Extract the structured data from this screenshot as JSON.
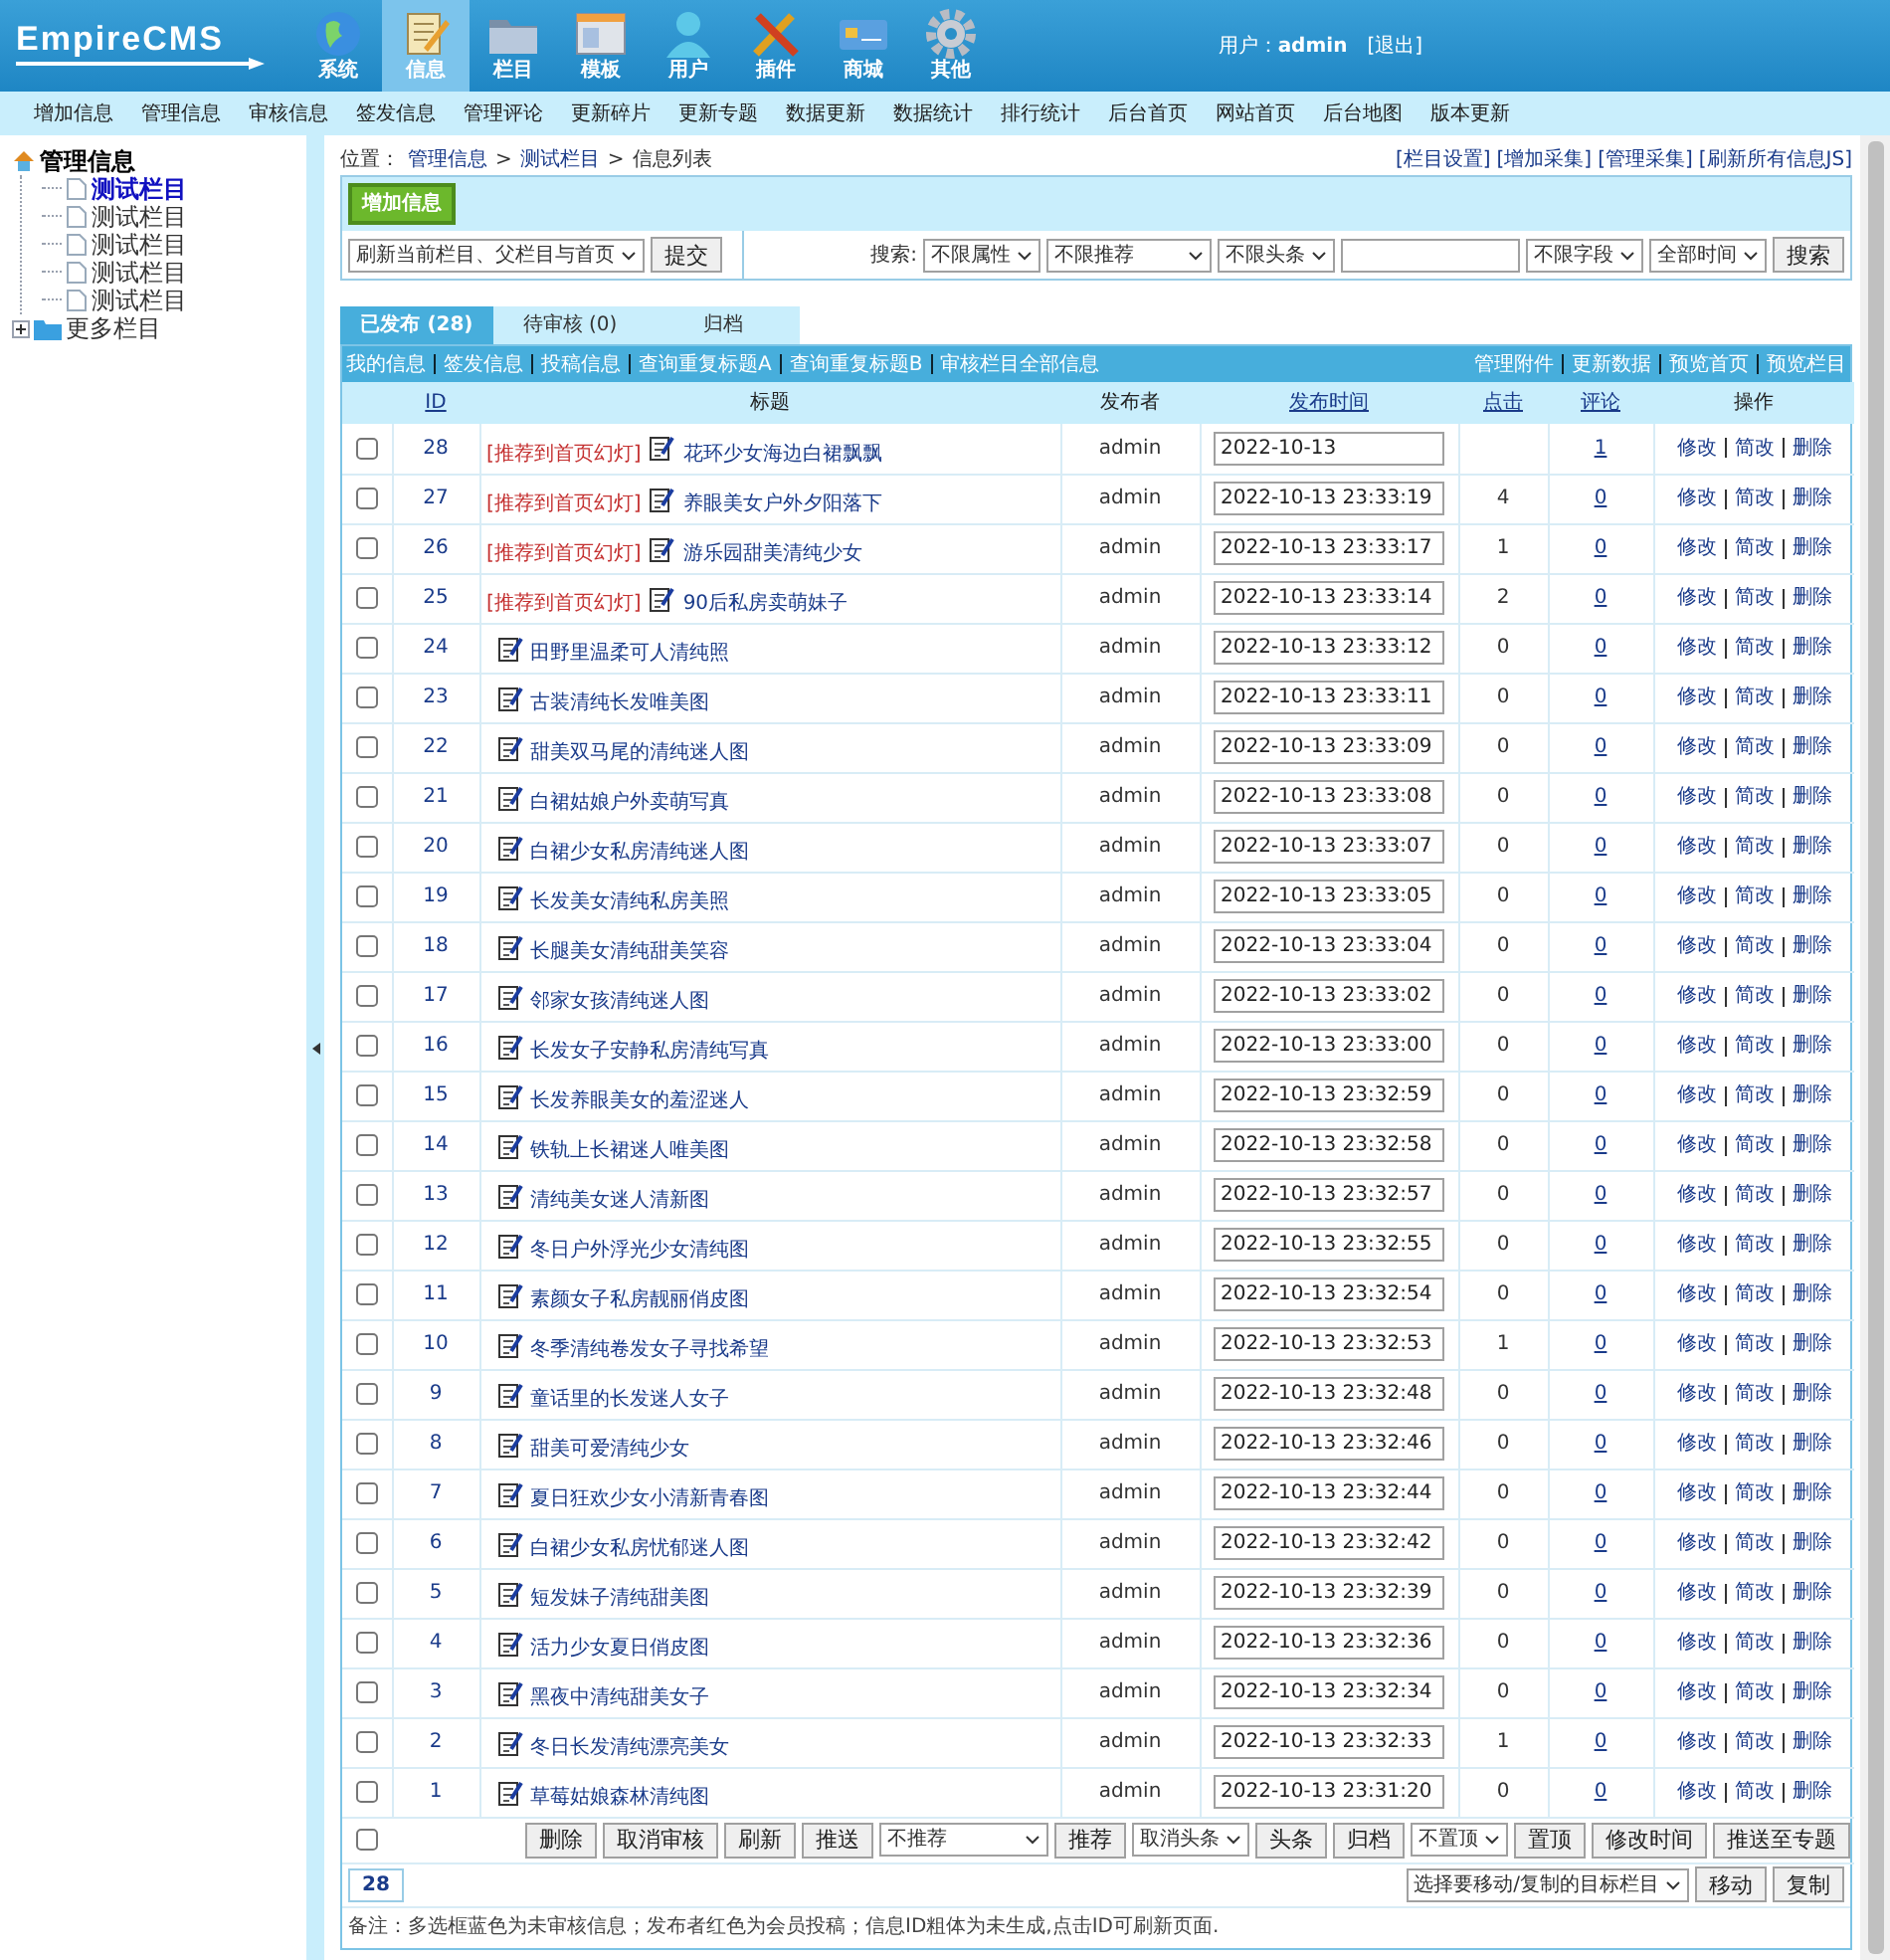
{
  "header": {
    "logo": "EmpireCMS",
    "modules": [
      {
        "label": "系统",
        "kind": "globe",
        "selected": false
      },
      {
        "label": "信息",
        "kind": "note",
        "selected": true
      },
      {
        "label": "栏目",
        "kind": "folder",
        "selected": false
      },
      {
        "label": "模板",
        "kind": "window",
        "selected": false
      },
      {
        "label": "用户",
        "kind": "person",
        "selected": false
      },
      {
        "label": "插件",
        "kind": "tools",
        "selected": false
      },
      {
        "label": "商城",
        "kind": "card",
        "selected": false
      },
      {
        "label": "其他",
        "kind": "gear",
        "selected": false
      }
    ],
    "user_label": "用户：",
    "user": "admin",
    "logout": "[退出]"
  },
  "menu": [
    "增加信息",
    "管理信息",
    "审核信息",
    "签发信息",
    "管理评论",
    "更新碎片",
    "更新专题",
    "数据更新",
    "数据统计",
    "排行统计",
    "后台首页",
    "网站首页",
    "后台地图",
    "版本更新"
  ],
  "sidebar": {
    "tree": [
      {
        "label": "管理信息",
        "kind": "home",
        "selected": false,
        "children": [
          {
            "label": "测试栏目",
            "kind": "page",
            "selected": true
          },
          {
            "label": "测试栏目",
            "kind": "page",
            "selected": false
          },
          {
            "label": "测试栏目",
            "kind": "page",
            "selected": false
          },
          {
            "label": "测试栏目",
            "kind": "page",
            "selected": false
          },
          {
            "label": "测试栏目",
            "kind": "page",
            "selected": false
          }
        ]
      },
      {
        "label": "更多栏目",
        "kind": "folder",
        "expanded": false,
        "selected": false
      }
    ]
  },
  "breadcrumb": {
    "prefix": "位置：",
    "parts": [
      "管理信息",
      "测试栏目",
      "信息列表"
    ],
    "separator": ">"
  },
  "top_links": [
    "[栏目设置]",
    "[增加采集]",
    "[管理采集]",
    "[刷新所有信息JS]"
  ],
  "toolbar": {
    "add_button": "增加信息",
    "refresh_select": "刷新当前栏目、父栏目与首页",
    "submit": "提交",
    "search_label": "搜索:",
    "filters": [
      {
        "value": "不限属性",
        "kind": "select"
      },
      {
        "value": "不限推荐",
        "kind": "select-wide"
      },
      {
        "value": "不限头条",
        "kind": "select"
      },
      {
        "kind": "input"
      },
      {
        "value": "不限字段",
        "kind": "select"
      },
      {
        "value": "全部时间",
        "kind": "select"
      }
    ],
    "search_button": "搜索"
  },
  "tabs": [
    {
      "label": "已发布 (28)",
      "selected": true
    },
    {
      "label": "待审核 (0)",
      "selected": false
    },
    {
      "label": "归档",
      "selected": false
    }
  ],
  "bar_links_left": [
    "我的信息",
    "签发信息",
    "投稿信息",
    "查询重复标题A",
    "查询重复标题B",
    "审核栏目全部信息"
  ],
  "bar_links_right": [
    "管理附件",
    "更新数据",
    "预览首页",
    "预览栏目"
  ],
  "table": {
    "columns": [
      {
        "label": "ID",
        "sortable": true
      },
      {
        "label": "标题",
        "sortable": false
      },
      {
        "label": "发布者",
        "sortable": false
      },
      {
        "label": "发布时间",
        "sortable": true
      },
      {
        "label": "点击",
        "sortable": true
      },
      {
        "label": "评论",
        "sortable": true
      },
      {
        "label": "操作",
        "sortable": false
      }
    ],
    "rows": [
      {
        "id": "28",
        "tag": "[推荐到首页幻灯]",
        "title": "花环少女海边白裙飘飘",
        "author": "admin",
        "time": "2022-10-13",
        "clicks": "",
        "comments": "1",
        "checked": false,
        "actions": [
          "修改",
          "简改",
          "删除"
        ]
      },
      {
        "id": "27",
        "tag": "[推荐到首页幻灯]",
        "title": "养眼美女户外夕阳落下",
        "author": "admin",
        "time": "2022-10-13 23:33:19",
        "clicks": "4",
        "comments": "0",
        "checked": false,
        "actions": [
          "修改",
          "简改",
          "删除"
        ]
      },
      {
        "id": "26",
        "tag": "[推荐到首页幻灯]",
        "title": "游乐园甜美清纯少女",
        "author": "admin",
        "time": "2022-10-13 23:33:17",
        "clicks": "1",
        "comments": "0",
        "checked": false,
        "actions": [
          "修改",
          "简改",
          "删除"
        ]
      },
      {
        "id": "25",
        "tag": "[推荐到首页幻灯]",
        "title": "90后私房卖萌妹子",
        "author": "admin",
        "time": "2022-10-13 23:33:14",
        "clicks": "2",
        "comments": "0",
        "checked": false,
        "actions": [
          "修改",
          "简改",
          "删除"
        ]
      },
      {
        "id": "24",
        "title": "田野里温柔可人清纯照",
        "author": "admin",
        "time": "2022-10-13 23:33:12",
        "clicks": "0",
        "comments": "0",
        "checked": false,
        "actions": [
          "修改",
          "简改",
          "删除"
        ]
      },
      {
        "id": "23",
        "title": "古装清纯长发唯美图",
        "author": "admin",
        "time": "2022-10-13 23:33:11",
        "clicks": "0",
        "comments": "0",
        "checked": false,
        "actions": [
          "修改",
          "简改",
          "删除"
        ]
      },
      {
        "id": "22",
        "title": "甜美双马尾的清纯迷人图",
        "author": "admin",
        "time": "2022-10-13 23:33:09",
        "clicks": "0",
        "comments": "0",
        "checked": false,
        "actions": [
          "修改",
          "简改",
          "删除"
        ]
      },
      {
        "id": "21",
        "title": "白裙姑娘户外卖萌写真",
        "author": "admin",
        "time": "2022-10-13 23:33:08",
        "clicks": "0",
        "comments": "0",
        "checked": false,
        "actions": [
          "修改",
          "简改",
          "删除"
        ]
      },
      {
        "id": "20",
        "title": "白裙少女私房清纯迷人图",
        "author": "admin",
        "time": "2022-10-13 23:33:07",
        "clicks": "0",
        "comments": "0",
        "checked": false,
        "actions": [
          "修改",
          "简改",
          "删除"
        ]
      },
      {
        "id": "19",
        "title": "长发美女清纯私房美照",
        "author": "admin",
        "time": "2022-10-13 23:33:05",
        "clicks": "0",
        "comments": "0",
        "checked": false,
        "actions": [
          "修改",
          "简改",
          "删除"
        ]
      },
      {
        "id": "18",
        "title": "长腿美女清纯甜美笑容",
        "author": "admin",
        "time": "2022-10-13 23:33:04",
        "clicks": "0",
        "comments": "0",
        "checked": false,
        "actions": [
          "修改",
          "简改",
          "删除"
        ]
      },
      {
        "id": "17",
        "title": "邻家女孩清纯迷人图",
        "author": "admin",
        "time": "2022-10-13 23:33:02",
        "clicks": "0",
        "comments": "0",
        "checked": false,
        "actions": [
          "修改",
          "简改",
          "删除"
        ]
      },
      {
        "id": "16",
        "title": "长发女子安静私房清纯写真",
        "author": "admin",
        "time": "2022-10-13 23:33:00",
        "clicks": "0",
        "comments": "0",
        "checked": false,
        "actions": [
          "修改",
          "简改",
          "删除"
        ]
      },
      {
        "id": "15",
        "title": "长发养眼美女的羞涩迷人",
        "author": "admin",
        "time": "2022-10-13 23:32:59",
        "clicks": "0",
        "comments": "0",
        "checked": false,
        "actions": [
          "修改",
          "简改",
          "删除"
        ]
      },
      {
        "id": "14",
        "title": "铁轨上长裙迷人唯美图",
        "author": "admin",
        "time": "2022-10-13 23:32:58",
        "clicks": "0",
        "comments": "0",
        "checked": false,
        "actions": [
          "修改",
          "简改",
          "删除"
        ]
      },
      {
        "id": "13",
        "title": "清纯美女迷人清新图",
        "author": "admin",
        "time": "2022-10-13 23:32:57",
        "clicks": "0",
        "comments": "0",
        "checked": false,
        "actions": [
          "修改",
          "简改",
          "删除"
        ]
      },
      {
        "id": "12",
        "title": "冬日户外浮光少女清纯图",
        "author": "admin",
        "time": "2022-10-13 23:32:55",
        "clicks": "0",
        "comments": "0",
        "checked": false,
        "actions": [
          "修改",
          "简改",
          "删除"
        ]
      },
      {
        "id": "11",
        "title": "素颜女子私房靓丽俏皮图",
        "author": "admin",
        "time": "2022-10-13 23:32:54",
        "clicks": "0",
        "comments": "0",
        "checked": false,
        "actions": [
          "修改",
          "简改",
          "删除"
        ]
      },
      {
        "id": "10",
        "title": "冬季清纯卷发女子寻找希望",
        "author": "admin",
        "time": "2022-10-13 23:32:53",
        "clicks": "1",
        "comments": "0",
        "checked": false,
        "actions": [
          "修改",
          "简改",
          "删除"
        ]
      },
      {
        "id": "9",
        "title": "童话里的长发迷人女子",
        "author": "admin",
        "time": "2022-10-13 23:32:48",
        "clicks": "0",
        "comments": "0",
        "checked": false,
        "actions": [
          "修改",
          "简改",
          "删除"
        ]
      },
      {
        "id": "8",
        "title": "甜美可爱清纯少女",
        "author": "admin",
        "time": "2022-10-13 23:32:46",
        "clicks": "0",
        "comments": "0",
        "checked": false,
        "actions": [
          "修改",
          "简改",
          "删除"
        ]
      },
      {
        "id": "7",
        "title": "夏日狂欢少女小清新青春图",
        "author": "admin",
        "time": "2022-10-13 23:32:44",
        "clicks": "0",
        "comments": "0",
        "checked": false,
        "actions": [
          "修改",
          "简改",
          "删除"
        ]
      },
      {
        "id": "6",
        "title": "白裙少女私房忧郁迷人图",
        "author": "admin",
        "time": "2022-10-13 23:32:42",
        "clicks": "0",
        "comments": "0",
        "checked": false,
        "actions": [
          "修改",
          "简改",
          "删除"
        ]
      },
      {
        "id": "5",
        "title": "短发妹子清纯甜美图",
        "author": "admin",
        "time": "2022-10-13 23:32:39",
        "clicks": "0",
        "comments": "0",
        "checked": false,
        "actions": [
          "修改",
          "简改",
          "删除"
        ]
      },
      {
        "id": "4",
        "title": "活力少女夏日俏皮图",
        "author": "admin",
        "time": "2022-10-13 23:32:36",
        "clicks": "0",
        "comments": "0",
        "checked": false,
        "actions": [
          "修改",
          "简改",
          "删除"
        ]
      },
      {
        "id": "3",
        "title": "黑夜中清纯甜美女子",
        "author": "admin",
        "time": "2022-10-13 23:32:34",
        "clicks": "0",
        "comments": "0",
        "checked": false,
        "actions": [
          "修改",
          "简改",
          "删除"
        ]
      },
      {
        "id": "2",
        "title": "冬日长发清纯漂亮美女",
        "author": "admin",
        "time": "2022-10-13 23:32:33",
        "clicks": "1",
        "comments": "0",
        "checked": false,
        "actions": [
          "修改",
          "简改",
          "删除"
        ]
      },
      {
        "id": "1",
        "title": "草莓姑娘森林清纯图",
        "author": "admin",
        "time": "2022-10-13 23:31:20",
        "clicks": "0",
        "comments": "0",
        "checked": false,
        "actions": [
          "修改",
          "简改",
          "删除"
        ]
      }
    ]
  },
  "bulk": {
    "select_all_checked": false,
    "controls": [
      {
        "kind": "button",
        "label": "删除"
      },
      {
        "kind": "button",
        "label": "取消审核"
      },
      {
        "kind": "button",
        "label": "刷新"
      },
      {
        "kind": "button",
        "label": "推送"
      },
      {
        "kind": "select-wide",
        "label": "不推荐"
      },
      {
        "kind": "button",
        "label": "推荐"
      },
      {
        "kind": "select",
        "label": "取消头条"
      },
      {
        "kind": "button",
        "label": "头条"
      },
      {
        "kind": "button",
        "label": "归档"
      },
      {
        "kind": "select",
        "label": "不置顶"
      },
      {
        "kind": "button",
        "label": "置顶"
      },
      {
        "kind": "button",
        "label": "修改时间"
      },
      {
        "kind": "button",
        "label": "推送至专题"
      }
    ]
  },
  "pager": {
    "page": "28",
    "move_select": "选择要移动/复制的目标栏目",
    "move": "移动",
    "copy": "复制"
  },
  "note": "备注：多选框蓝色为未审核信息；发布者红色为会员投稿；信息ID粗体为未生成,点击ID可刷新页面."
}
